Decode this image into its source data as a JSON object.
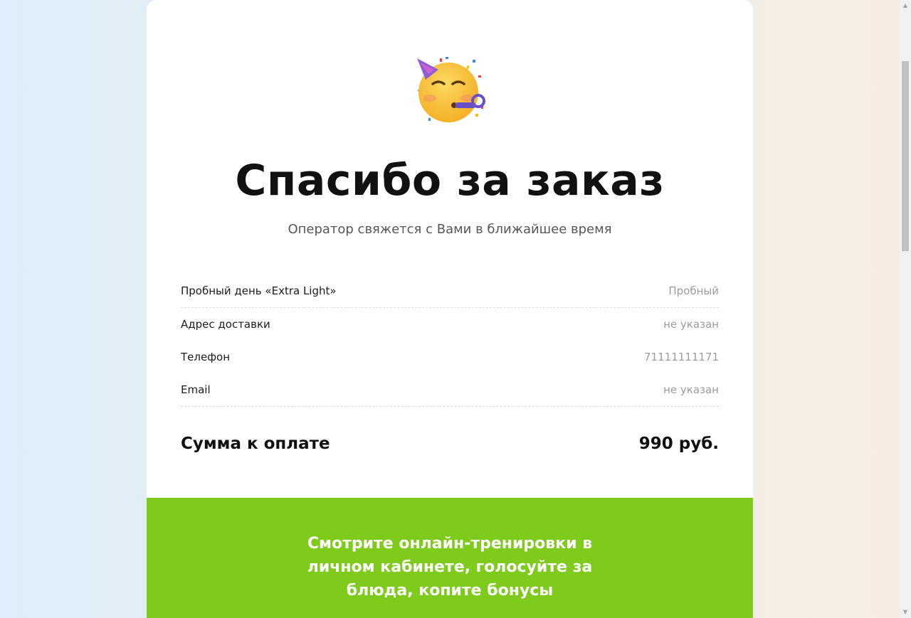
{
  "header": {
    "emoji": "partying-face-icon",
    "title": "Спасибо за заказ",
    "subtitle": "Оператор свяжется с Вами в ближайшее время"
  },
  "order": {
    "rows": [
      {
        "label": "Пробный день «Extra Light»",
        "value": "Пробный"
      },
      {
        "label": "Адрес доставки",
        "value": "не указан"
      },
      {
        "label": "Телефон",
        "value": "71111111171"
      },
      {
        "label": "Email",
        "value": "не указан"
      }
    ],
    "total_label": "Сумма к оплате",
    "total_value": "990 руб."
  },
  "promo": {
    "text": "Смотрите онлайн-тренировки в личном кабинете, голосуйте за блюда, копите бонусы",
    "background": "#7ecb1c"
  },
  "scrollbar": {
    "up_arrow": "▲",
    "down_arrow": "▼"
  }
}
